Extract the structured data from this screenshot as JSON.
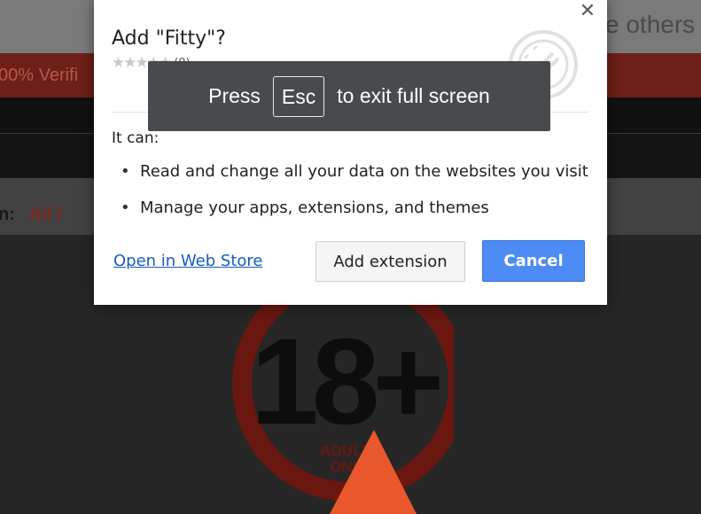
{
  "background": {
    "top_text": "e others",
    "red_bar_text": "00% Verifi",
    "filter_label": "n:",
    "filter_value": "All /",
    "badge": {
      "number": "18+",
      "caption_line1": "ADULTS",
      "caption_line2": "ONLY"
    }
  },
  "fullscreen_toast": {
    "prefix": "Press",
    "key": "Esc",
    "suffix": "to exit full screen"
  },
  "dialog": {
    "close_symbol": "✕",
    "title": "Add \"Fitty\"?",
    "stars": "★★★★★",
    "rating_count": "(0)",
    "it_can": "It can:",
    "permissions": [
      "Read and change all your data on the websites you visit",
      "Manage your apps, extensions, and themes"
    ],
    "bullet": "•",
    "web_store_link": "Open in Web Store",
    "add_button": "Add extension",
    "cancel_button": "Cancel"
  },
  "colors": {
    "accent_blue": "#4d8cf5",
    "link_blue": "#1a5bbf",
    "badge_red": "#6a1710",
    "arrow_orange": "#e8582c"
  }
}
